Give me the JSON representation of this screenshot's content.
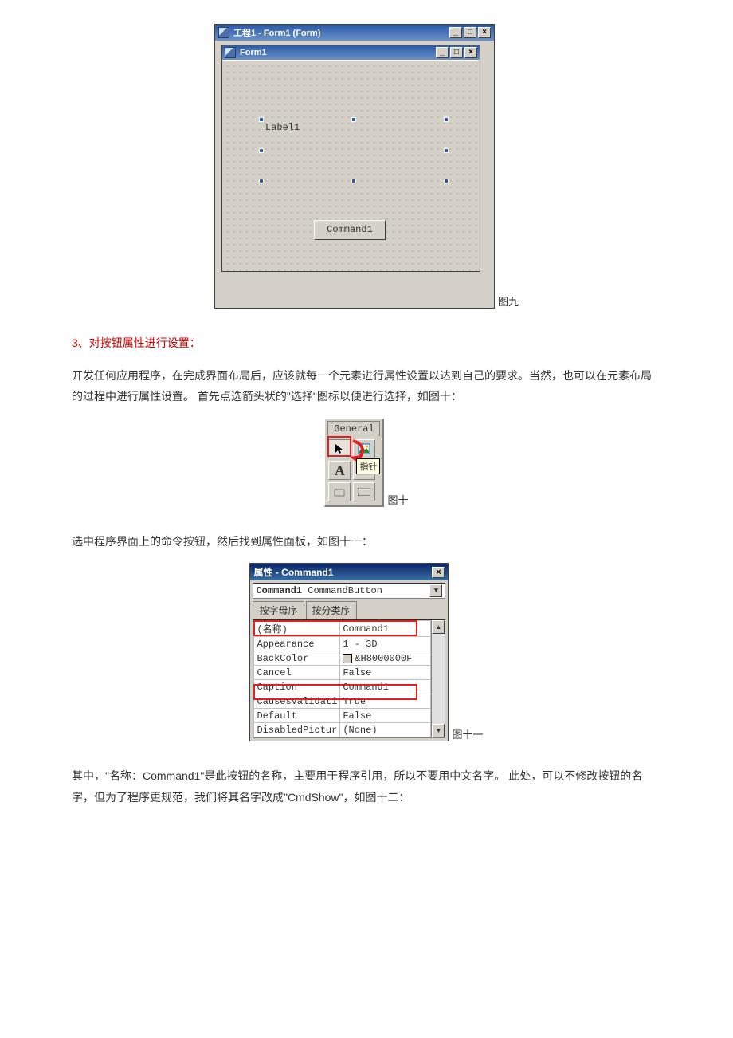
{
  "fig9": {
    "outer_title": "工程1 - Form1 (Form)",
    "inner_title": "Form1",
    "label_text": "Label1",
    "button_text": "Command1",
    "caption": "图九"
  },
  "section3": {
    "heading": "3、对按钮属性进行设置：",
    "para1": "开发任何应用程序，在完成界面布局后，应该就每一个元素进行属性设置以达到自己的要求。当然，也可以在元素布局的过程中进行属性设置。 首先点选箭头状的\"选择\"图标以便进行选择，如图十："
  },
  "fig10": {
    "tab_label": "General",
    "tooltip": "指针",
    "caption": "图十"
  },
  "para_after10": "选中程序界面上的命令按钮，然后找到属性面板，如图十一：",
  "fig11": {
    "title": "属性 - Command1",
    "combo_name": "Command1",
    "combo_type": "CommandButton",
    "tab_alpha": "按字母序",
    "tab_cat": "按分类序",
    "rows": [
      {
        "name": "(名称)",
        "value": "Command1"
      },
      {
        "name": "Appearance",
        "value": "1 - 3D"
      },
      {
        "name": "BackColor",
        "value": "&H8000000F"
      },
      {
        "name": "Cancel",
        "value": "False"
      },
      {
        "name": "Caption",
        "value": "Command1"
      },
      {
        "name": "CausesValidati",
        "value": "True"
      },
      {
        "name": "Default",
        "value": "False"
      },
      {
        "name": "DisabledPictur",
        "value": "(None)"
      }
    ],
    "caption": "图十一"
  },
  "para_after11": "其中，\"名称：Command1\"是此按钮的名称，主要用于程序引用，所以不要用中文名字。 此处，可以不修改按钮的名字，但为了程序更规范，我们将其名字改成\"CmdShow\"，如图十二："
}
